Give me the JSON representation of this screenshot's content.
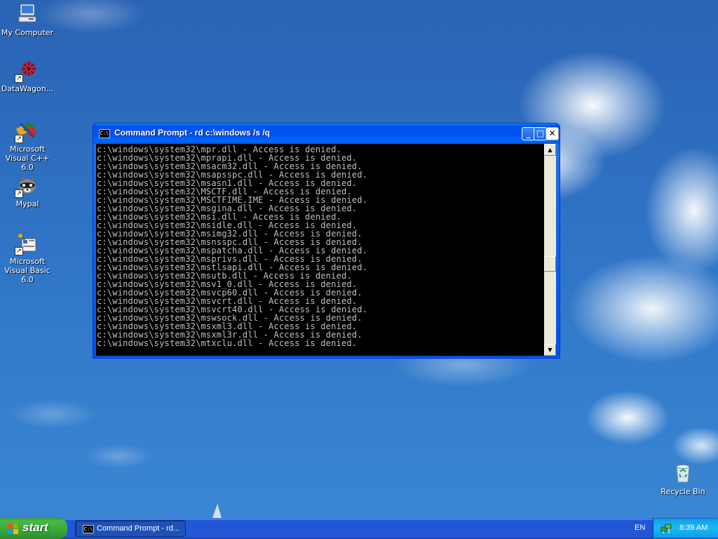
{
  "desktop": {
    "icons": [
      {
        "label": "My Computer"
      },
      {
        "label": "DataWagon..."
      },
      {
        "label": "Microsoft Visual C++ 6.0"
      },
      {
        "label": "Mypal"
      },
      {
        "label": "Microsoft Visual Basic 6.0"
      },
      {
        "label": "Recycle Bin"
      }
    ]
  },
  "window": {
    "title": "Command Prompt - rd c:\\windows /s /q",
    "icon_text": "C:\\",
    "minimize_glyph": "_",
    "maximize_glyph": "□",
    "close_glyph": "✕",
    "console_lines": [
      "c:\\windows\\system32\\mpr.dll - Access is denied.",
      "c:\\windows\\system32\\mprapi.dll - Access is denied.",
      "c:\\windows\\system32\\msacm32.dll - Access is denied.",
      "c:\\windows\\system32\\msapsspc.dll - Access is denied.",
      "c:\\windows\\system32\\msasn1.dll - Access is denied.",
      "c:\\windows\\system32\\MSCTF.dll - Access is denied.",
      "c:\\windows\\system32\\MSCTFIME.IME - Access is denied.",
      "c:\\windows\\system32\\msgina.dll - Access is denied.",
      "c:\\windows\\system32\\msi.dll - Access is denied.",
      "c:\\windows\\system32\\msidle.dll - Access is denied.",
      "c:\\windows\\system32\\msimg32.dll - Access is denied.",
      "c:\\windows\\system32\\msnsspc.dll - Access is denied.",
      "c:\\windows\\system32\\mspatcha.dll - Access is denied.",
      "c:\\windows\\system32\\msprivs.dll - Access is denied.",
      "c:\\windows\\system32\\mstlsapi.dll - Access is denied.",
      "c:\\windows\\system32\\msutb.dll - Access is denied.",
      "c:\\windows\\system32\\msv1_0.dll - Access is denied.",
      "c:\\windows\\system32\\msvcp60.dll - Access is denied.",
      "c:\\windows\\system32\\msvcrt.dll - Access is denied.",
      "c:\\windows\\system32\\msvcrt40.dll - Access is denied.",
      "c:\\windows\\system32\\mswsock.dll - Access is denied.",
      "c:\\windows\\system32\\msxml3.dll - Access is denied.",
      "c:\\windows\\system32\\msxml3r.dll - Access is denied.",
      "c:\\windows\\system32\\mtxclu.dll - Access is denied."
    ],
    "scroll_position": 0.58
  },
  "taskbar": {
    "start_label": "start",
    "task_button_label": "Command Prompt - rd...",
    "language": "EN",
    "clock": "8:39 AM"
  },
  "colors": {
    "console_bg": "#000000",
    "console_fg": "#c0c0c0",
    "titlebar": "#0054e3",
    "taskbar": "#2157d7",
    "start_button": "#38a838"
  }
}
